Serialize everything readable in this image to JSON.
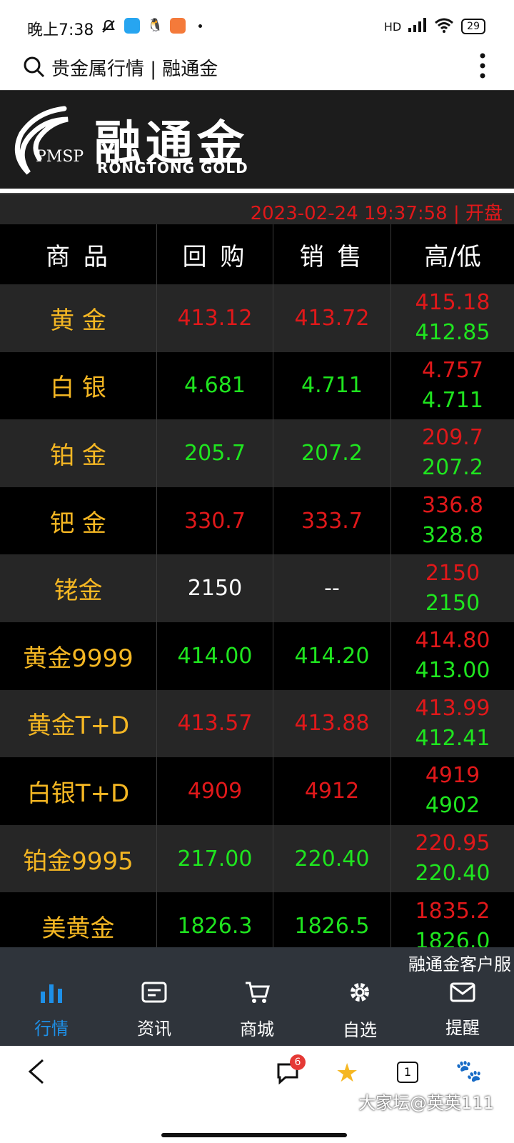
{
  "status_bar": {
    "time": "晚上7:38",
    "network": "HD",
    "battery": "29"
  },
  "browser": {
    "url_title": "贵金属行情 | 融通金"
  },
  "banner": {
    "logo_text": "PMSP",
    "brand_cn": "融通金",
    "brand_en": "RONGTONG GOLD"
  },
  "market_status": {
    "datetime": "2023-02-24 19:37:58 | 开盘"
  },
  "table": {
    "headers": [
      "商 品",
      "回 购",
      "销 售",
      "高/低"
    ],
    "rows": [
      {
        "name": "黄 金",
        "buy": "413.12",
        "sell": "413.72",
        "high": "415.18",
        "low": "412.85",
        "buy_color": "red",
        "sell_color": "red"
      },
      {
        "name": "白 银",
        "buy": "4.681",
        "sell": "4.711",
        "high": "4.757",
        "low": "4.711",
        "buy_color": "green",
        "sell_color": "green"
      },
      {
        "name": "铂 金",
        "buy": "205.7",
        "sell": "207.2",
        "high": "209.7",
        "low": "207.2",
        "buy_color": "green",
        "sell_color": "green"
      },
      {
        "name": "钯 金",
        "buy": "330.7",
        "sell": "333.7",
        "high": "336.8",
        "low": "328.8",
        "buy_color": "red",
        "sell_color": "red"
      },
      {
        "name": "铑金",
        "buy": "2150",
        "sell": "--",
        "high": "2150",
        "low": "2150",
        "buy_color": "white",
        "sell_color": "white"
      },
      {
        "name": "黄金9999",
        "buy": "414.00",
        "sell": "414.20",
        "high": "414.80",
        "low": "413.00",
        "buy_color": "green",
        "sell_color": "green"
      },
      {
        "name": "黄金T+D",
        "buy": "413.57",
        "sell": "413.88",
        "high": "413.99",
        "low": "412.41",
        "buy_color": "red",
        "sell_color": "red"
      },
      {
        "name": "白银T+D",
        "buy": "4909",
        "sell": "4912",
        "high": "4919",
        "low": "4902",
        "buy_color": "red",
        "sell_color": "red"
      },
      {
        "name": "铂金9995",
        "buy": "217.00",
        "sell": "220.40",
        "high": "220.95",
        "low": "220.40",
        "buy_color": "green",
        "sell_color": "green"
      },
      {
        "name": "美黄金",
        "buy": "1826.3",
        "sell": "1826.5",
        "high": "1835.2",
        "low": "1826.0",
        "buy_color": "green",
        "sell_color": "green"
      }
    ]
  },
  "marquee": {
    "text": "融通金客户服"
  },
  "bottom_nav": [
    {
      "label": "行情",
      "icon": "chart-bar-icon",
      "active": true
    },
    {
      "label": "资讯",
      "icon": "news-icon",
      "active": false
    },
    {
      "label": "商城",
      "icon": "cart-icon",
      "active": false
    },
    {
      "label": "自选",
      "icon": "gear-icon",
      "active": false
    },
    {
      "label": "提醒",
      "icon": "mail-icon",
      "active": false
    }
  ],
  "system_nav": {
    "chat_badge": "6",
    "tab_count": "1",
    "watermark": "大家坛@英英111"
  },
  "colors": {
    "red": "#e0181a",
    "green": "#1fe51f",
    "gold": "#f5b723",
    "active": "#1e90e8"
  }
}
